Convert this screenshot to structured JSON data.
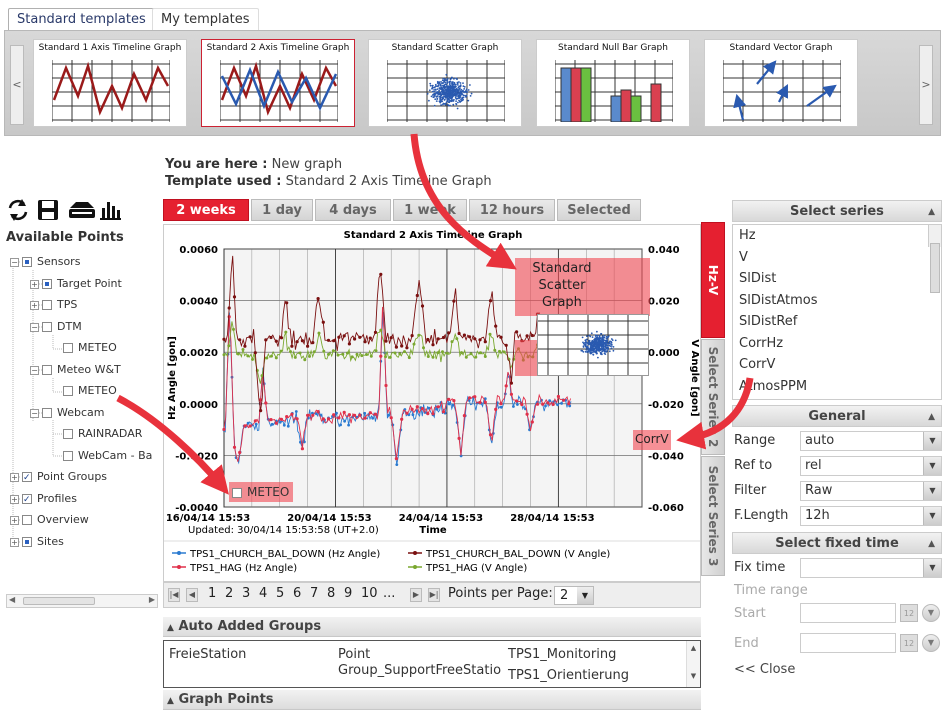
{
  "top_tabs": [
    "Standard templates",
    "My templates"
  ],
  "templates": [
    {
      "title": "Standard 1 Axis Timeline Graph",
      "icon": "line-graph-1-axis-icon"
    },
    {
      "title": "Standard 2 Axis Timeline Graph",
      "icon": "line-graph-2-axis-icon"
    },
    {
      "title": "Standard Scatter Graph",
      "icon": "scatter-graph-icon"
    },
    {
      "title": "Standard Null Bar Graph",
      "icon": "bar-graph-icon"
    },
    {
      "title": "Standard Vector Graph",
      "icon": "vector-graph-icon"
    }
  ],
  "scroll_left": "<",
  "scroll_right": ">",
  "breadcrumb": {
    "label": "You are here :",
    "value": "New graph"
  },
  "template_used": {
    "label": "Template used :",
    "value": "Standard 2 Axis Timeline Graph"
  },
  "range_tabs": [
    "2 weeks",
    "1 day",
    "4 days",
    "1 week",
    "12 hours",
    "Selected"
  ],
  "toolbar_icons": [
    "refresh-icon",
    "save-icon",
    "printer-icon",
    "chart-icon"
  ],
  "available_points": "Available Points",
  "tree": [
    {
      "label": "Sensors"
    },
    {
      "label": "Target Point"
    },
    {
      "label": "TPS"
    },
    {
      "label": "DTM"
    },
    {
      "label": "METEO"
    },
    {
      "label": "Meteo W&T"
    },
    {
      "label": "METEO"
    },
    {
      "label": "Webcam"
    },
    {
      "label": "RAINRADAR"
    },
    {
      "label": "WebCam - Ba"
    },
    {
      "label": "Point Groups"
    },
    {
      "label": "Profiles"
    },
    {
      "label": "Overview"
    },
    {
      "label": "Sites"
    }
  ],
  "vertical_tabs": [
    "Hz-V",
    "Select Series 2",
    "Select Series 3"
  ],
  "chart_data": {
    "type": "line",
    "title": "Standard 2 Axis Timeline Graph",
    "xlabel": "Time",
    "ylabel": "Hz Angle [gon]",
    "y2label": "V Angle [gon]",
    "x_ticks": [
      "16/04/14 15:53",
      "20/04/14 15:53",
      "24/04/14 15:53",
      "28/04/14 15:53"
    ],
    "xlim_days": [
      0,
      15
    ],
    "ylim": [
      -0.004,
      0.006
    ],
    "y_ticks": [
      "0.0060",
      "0.0040",
      "0.0020",
      "0.0000",
      "-0.0020",
      "-0.0040"
    ],
    "y2lim": [
      -0.06,
      0.04
    ],
    "y2_ticks": [
      "0.040",
      "0.020",
      "0.000",
      "-0.020",
      "-0.040",
      "-0.060"
    ],
    "grid": true,
    "updated": "Updated: 30/04/14 15:53:58 (UT+2.0)",
    "series": [
      {
        "name": "TPS1_CHURCH_BAL_DOWN (Hz Angle)",
        "color": "#2a7ad0",
        "axis": "left"
      },
      {
        "name": "TPS1_CHURCH_BAL_DOWN (V Angle)",
        "color": "#7a1010",
        "axis": "right"
      },
      {
        "name": "TPS1_HAG (Hz Angle)",
        "color": "#e0304a",
        "axis": "left"
      },
      {
        "name": "TPS1_HAG (V Angle)",
        "color": "#7aa830",
        "axis": "right"
      }
    ]
  },
  "overlays": {
    "scatter": "Standard\nScatter\nGraph",
    "meteo": "METEO",
    "corrv": "CorrV"
  },
  "pager": {
    "pages": [
      "1",
      "2",
      "3",
      "4",
      "5",
      "6",
      "7",
      "8",
      "9",
      "10",
      "..."
    ],
    "per_page_label": "Points per Page:",
    "per_page": "2"
  },
  "auto_added_groups": {
    "title": "Auto Added Groups",
    "col1": "FreieStation",
    "col2_line1": "Point",
    "col2_line2": "Group_SupportFreeStatio",
    "col3_line1": "TPS1_Monitoring",
    "col3_line2": "TPS1_Orientierung"
  },
  "graph_points": "Graph Points",
  "select_series": {
    "title": "Select series",
    "items": [
      "Hz",
      "V",
      "SlDist",
      "SlDistAtmos",
      "SlDistRef",
      "CorrHz",
      "CorrV",
      "AtmosPPM"
    ]
  },
  "general": {
    "title": "General",
    "rows": [
      {
        "label": "Range",
        "value": "auto"
      },
      {
        "label": "Ref to",
        "value": "rel"
      },
      {
        "label": "Filter",
        "value": "Raw"
      },
      {
        "label": "F.Length",
        "value": "12h"
      }
    ]
  },
  "fixed_time": {
    "title": "Select fixed time",
    "fix_time_label": "Fix time",
    "time_range_label": "Time range",
    "start_label": "Start",
    "end_label": "End",
    "close_label": "<< Close"
  }
}
